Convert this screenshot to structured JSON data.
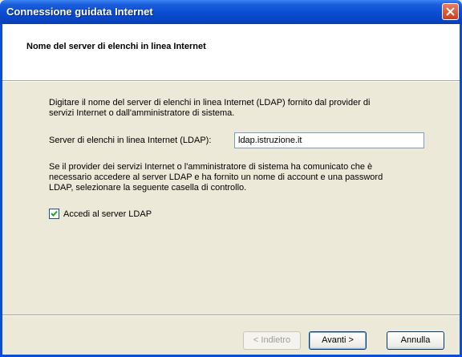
{
  "window": {
    "title": "Connessione guidata Internet"
  },
  "header": {
    "title": "Nome del server di elenchi in linea Internet"
  },
  "body": {
    "intro_line1": "Digitare il nome del server di elenchi in linea Internet (LDAP) fornito dal provider di",
    "intro_line2": "servizi Internet o dall'amministratore di sistema.",
    "server_label": "Server di elenchi in linea Internet (LDAP):",
    "server_value": "ldap.istruzione.it",
    "info_line1": "Se il provider dei servizi Internet o l'amministratore di sistema ha comunicato che è",
    "info_line2": "necessario accedere al server LDAP e ha fornito un nome di account e una password",
    "info_line3": "LDAP, selezionare la seguente casella di controllo.",
    "checkbox_label": "Accedi al server LDAP",
    "checkbox_checked": true
  },
  "buttons": {
    "back": "< Indietro",
    "next": "Avanti >",
    "cancel": "Annulla"
  }
}
